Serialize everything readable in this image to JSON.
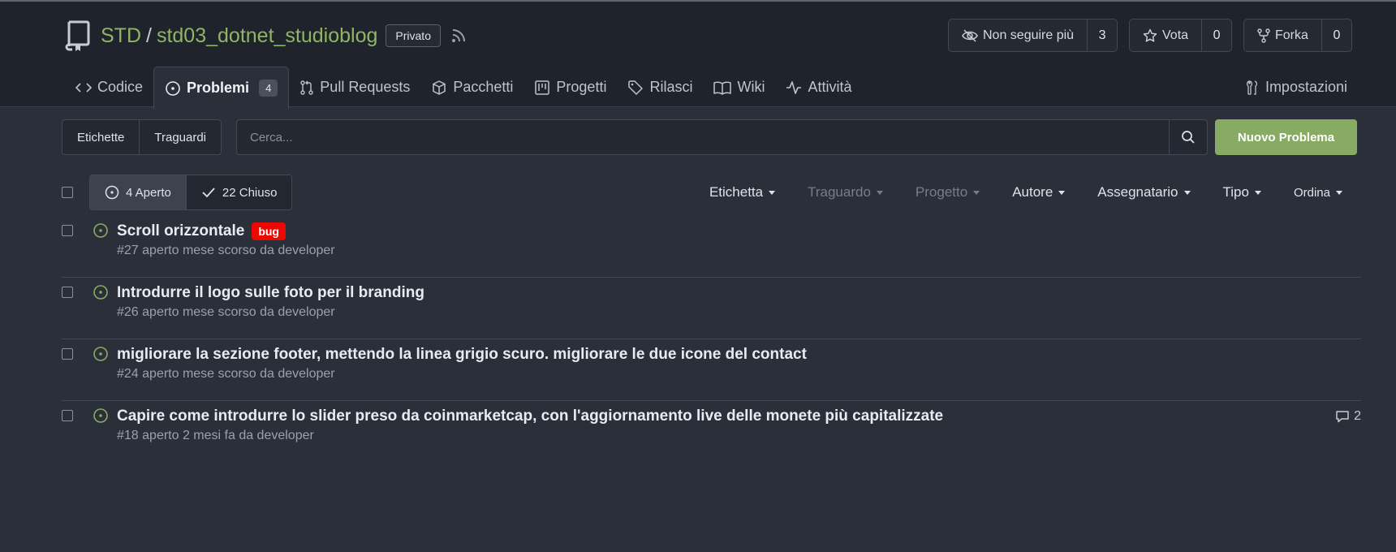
{
  "repo": {
    "owner": "STD",
    "separator": "/",
    "name": "std03_dotnet_studioblog",
    "visibility": "Privato"
  },
  "actions": {
    "watch": {
      "label": "Non seguire più",
      "count": "3"
    },
    "star": {
      "label": "Vota",
      "count": "0"
    },
    "fork": {
      "label": "Forka",
      "count": "0"
    }
  },
  "tabs": {
    "code": "Codice",
    "issues": "Problemi",
    "issues_count": "4",
    "pulls": "Pull Requests",
    "packages": "Pacchetti",
    "projects": "Progetti",
    "releases": "Rilasci",
    "wiki": "Wiki",
    "activity": "Attività",
    "settings": "Impostazioni"
  },
  "toolbar": {
    "labels_button": "Etichette",
    "milestones_button": "Traguardi",
    "search_placeholder": "Cerca...",
    "new_issue_button": "Nuovo Problema"
  },
  "state": {
    "open": "4 Aperto",
    "closed": "22 Chiuso"
  },
  "filters": {
    "label": "Etichetta",
    "milestone": "Traguardo",
    "project": "Progetto",
    "author": "Autore",
    "assignee": "Assegnatario",
    "type": "Tipo",
    "sort": "Ordina"
  },
  "issues": [
    {
      "title": "Scroll orizzontale",
      "label": "bug",
      "meta": "#27 aperto mese scorso da developer"
    },
    {
      "title": "Introdurre il logo sulle foto per il branding",
      "meta": "#26 aperto mese scorso da developer"
    },
    {
      "title": "migliorare la sezione footer, mettendo la linea grigio scuro. migliorare le due icone del contact",
      "meta": "#24 aperto mese scorso da developer"
    },
    {
      "title": "Capire come introdurre lo slider preso da coinmarketcap, con l'aggiornamento live delle monete più capitalizzate",
      "meta": "#18 aperto 2 mesi fa da developer",
      "comments": "2"
    }
  ],
  "colors": {
    "accent_green": "#87ab63",
    "repo_link": "#90b565",
    "bug_label": "#ee0701",
    "background": "#2b2f39",
    "header_bg": "#1f232b"
  }
}
